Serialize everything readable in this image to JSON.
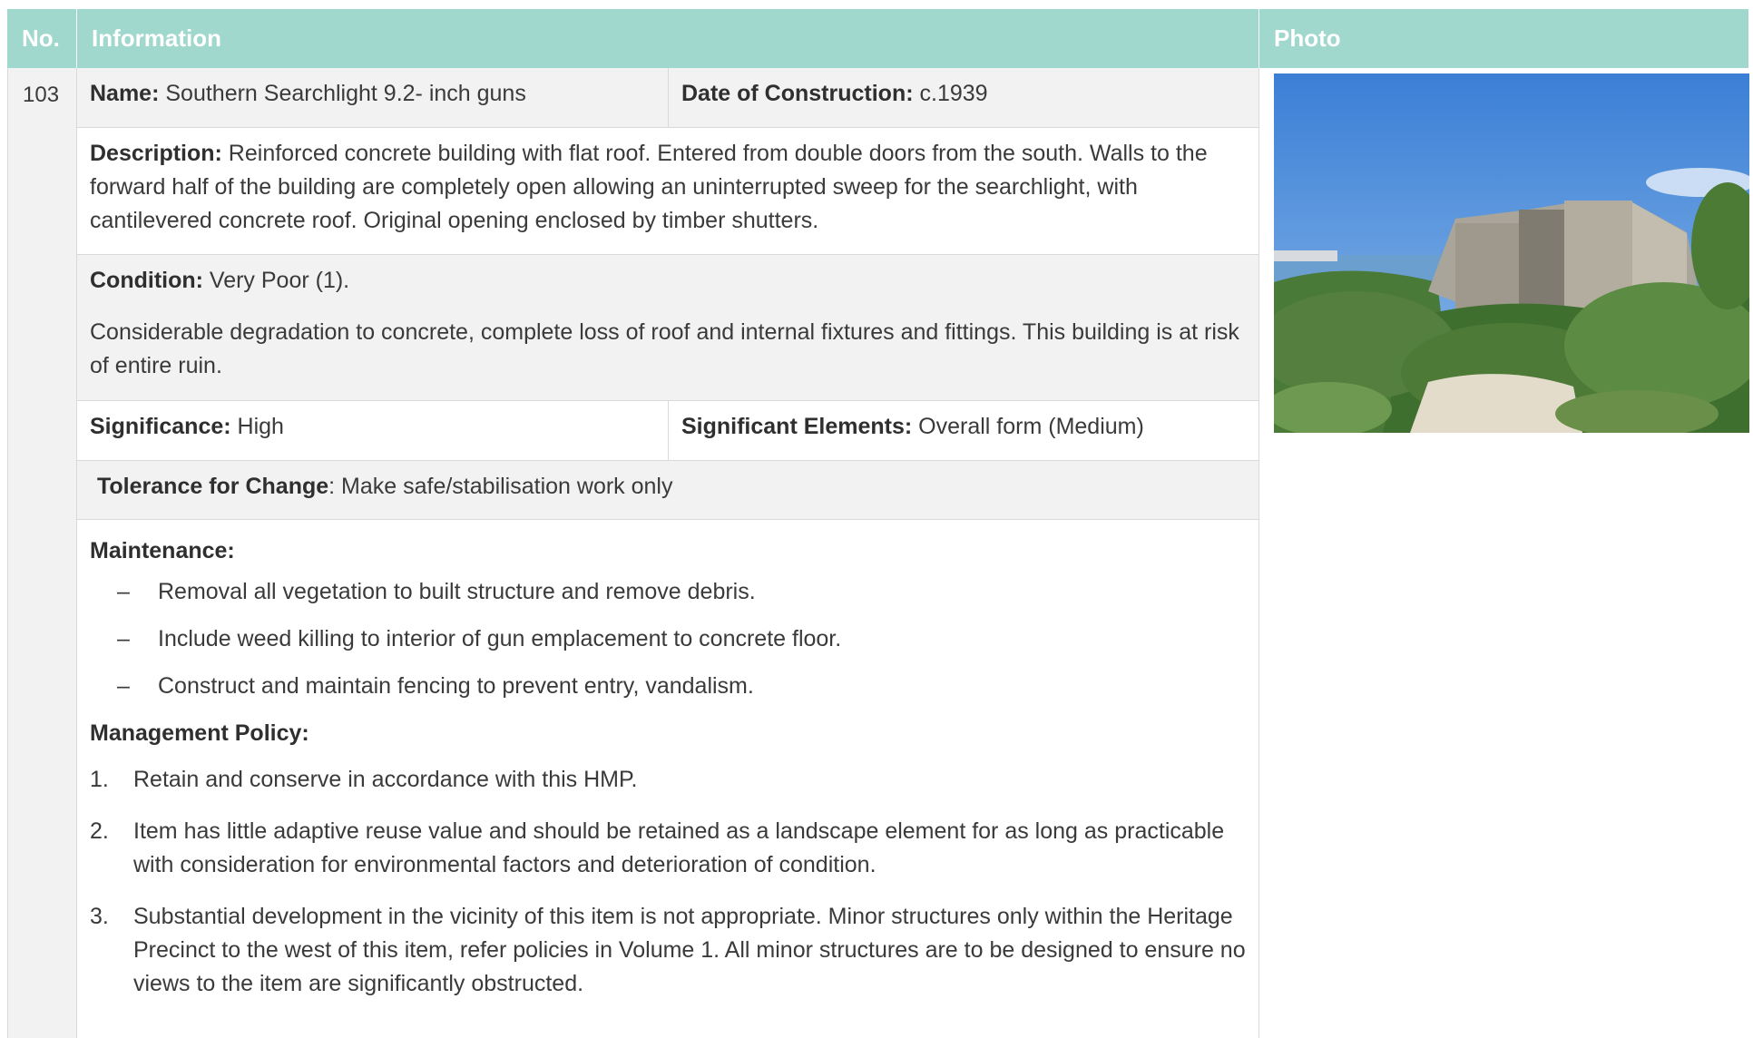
{
  "header": {
    "no": "No.",
    "information": "Information",
    "photo": "Photo"
  },
  "item": {
    "number": "103",
    "name_label": "Name:",
    "name_value": " Southern Searchlight 9.2- inch guns",
    "date_label": "Date of Construction:",
    "date_value": " c.1939",
    "description_label": "Description:",
    "description_value": " Reinforced concrete building with flat roof. Entered from double doors from the south. Walls to the forward half of the building are completely open allowing an uninterrupted sweep for the searchlight, with cantilevered concrete roof. Original opening enclosed by timber shutters.",
    "condition_label": "Condition:",
    "condition_value": " Very Poor (1).",
    "condition_detail": "Considerable degradation to concrete, complete loss of roof and internal fixtures and fittings. This building is at risk of entire ruin.",
    "significance_label": "Significance:",
    "significance_value": " High",
    "sig_elements_label": "Significant Elements:",
    "sig_elements_value": " Overall form (Medium)",
    "tolerance_label": "Tolerance for Change",
    "tolerance_value": ": Make safe/stabilisation work only",
    "maintenance_label": "Maintenance:",
    "maintenance_items": [
      {
        "marker": "–",
        "text": "Removal all vegetation to built structure and remove debris."
      },
      {
        "marker": "–",
        "text": "Include weed killing to interior of gun emplacement to concrete floor."
      },
      {
        "marker": "–",
        "text": "Construct and maintain fencing to prevent entry, vandalism."
      }
    ],
    "policy_label": "Management Policy:",
    "policy_items": [
      {
        "marker": "1.",
        "text": "Retain and conserve in accordance with this HMP."
      },
      {
        "marker": "2.",
        "text": "Item has little adaptive reuse value and should be retained as a landscape element for as long as practicable with consideration for environmental factors and deterioration of condition."
      },
      {
        "marker": "3.",
        "text": "Substantial development in the vicinity of this item is not appropriate. Minor structures only within the Heritage Precinct to the west of this item, refer policies in Volume 1. All minor structures are to be designed to ensure no views to the item are significantly obstructed."
      }
    ]
  },
  "colors": {
    "header_bg": "#a0d8cd",
    "header_text": "#ffffff",
    "row_grey": "#f2f2f2",
    "border": "#d9d9d9",
    "text": "#3a3a3a"
  }
}
